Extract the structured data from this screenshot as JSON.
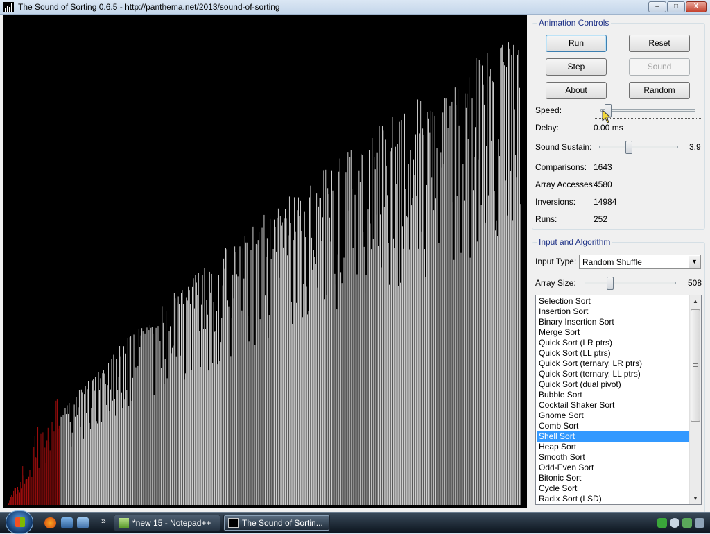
{
  "window": {
    "title": "The Sound of Sorting 0.6.5 - http://panthema.net/2013/sound-of-sorting",
    "controls": {
      "minimize": "–",
      "maximize": "□",
      "close": "X"
    }
  },
  "visualization": {
    "array_size": 508,
    "highlight_count": 51,
    "bar_color": "#ffffff",
    "highlight_color": "#cc1111",
    "background": "#000000"
  },
  "animation_controls": {
    "legend": "Animation Controls",
    "buttons": {
      "run": "Run",
      "reset": "Reset",
      "step": "Step",
      "sound": "Sound",
      "about": "About",
      "random": "Random"
    },
    "speed_label": "Speed:",
    "speed_level": 0.08,
    "delay_label": "Delay:",
    "delay_value": "0.00 ms",
    "sustain_label": "Sound Sustain:",
    "sustain_value": "3.9",
    "sustain_level": 0.38
  },
  "stats": {
    "comparisons_label": "Comparisons:",
    "comparisons": "1643",
    "accesses_label": "Array Accesses:",
    "accesses": "4580",
    "inversions_label": "Inversions:",
    "inversions": "14984",
    "runs_label": "Runs:",
    "runs": "252"
  },
  "input": {
    "legend": "Input and Algorithm",
    "type_label": "Input Type:",
    "type_value": "Random Shuffle",
    "size_label": "Array Size:",
    "size_value": "508",
    "size_level": 0.28
  },
  "algorithms": {
    "items": [
      "Selection Sort",
      "Insertion Sort",
      "Binary Insertion Sort",
      "Merge Sort",
      "Quick Sort (LR ptrs)",
      "Quick Sort (LL ptrs)",
      "Quick Sort (ternary, LR ptrs)",
      "Quick Sort (ternary, LL ptrs)",
      "Quick Sort (dual pivot)",
      "Bubble Sort",
      "Cocktail Shaker Sort",
      "Gnome Sort",
      "Comb Sort",
      "Shell Sort",
      "Heap Sort",
      "Smooth Sort",
      "Odd-Even Sort",
      "Bitonic Sort",
      "Cycle Sort",
      "Radix Sort (LSD)"
    ],
    "selected": "Shell Sort"
  },
  "taskbar": {
    "tasks": [
      "*new 15 - Notepad++",
      "The Sound of Sortin..."
    ],
    "chevron": "»"
  }
}
